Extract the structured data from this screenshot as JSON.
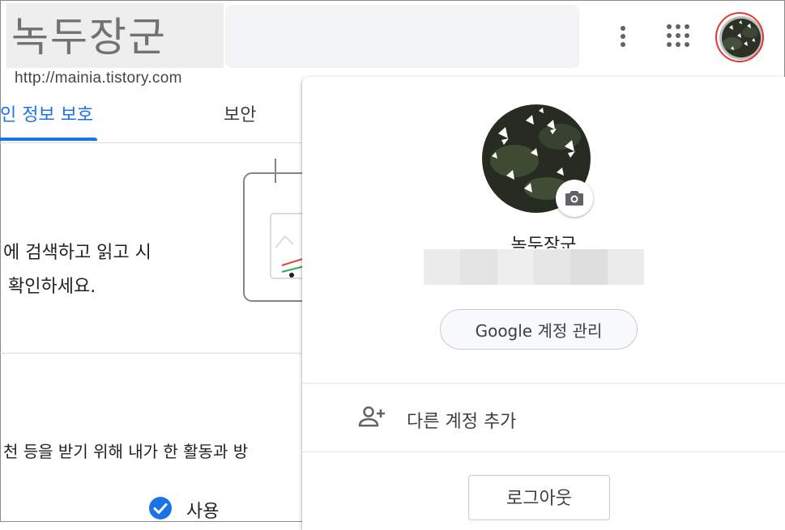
{
  "watermark": {
    "logo_text": "녹두장군",
    "url": "http://mainia.tistory.com"
  },
  "header": {
    "more_icon": "more-vert-icon",
    "apps_icon": "apps-grid-icon",
    "avatar_icon": "account-avatar-icon",
    "highlight_color": "#e53935"
  },
  "tabs": [
    {
      "label": "인 정보 보호",
      "active": true
    },
    {
      "label": "보안",
      "active": false
    }
  ],
  "content": {
    "card_line1": "에 검색하고 읽고 시",
    "card_line2": "확인하세요.",
    "activity_text": "천 등을 받기 위해 내가 한 활동과 방",
    "status_label": "사용",
    "status_icon": "check-circle-icon",
    "accent_color": "#1a73e8"
  },
  "account_menu": {
    "name": "녹두장군",
    "camera_icon": "camera-icon",
    "manage_button": "Google 계정 관리",
    "add_account_icon": "person-add-icon",
    "add_account": "다른 계정 추가",
    "logout": "로그아웃"
  }
}
